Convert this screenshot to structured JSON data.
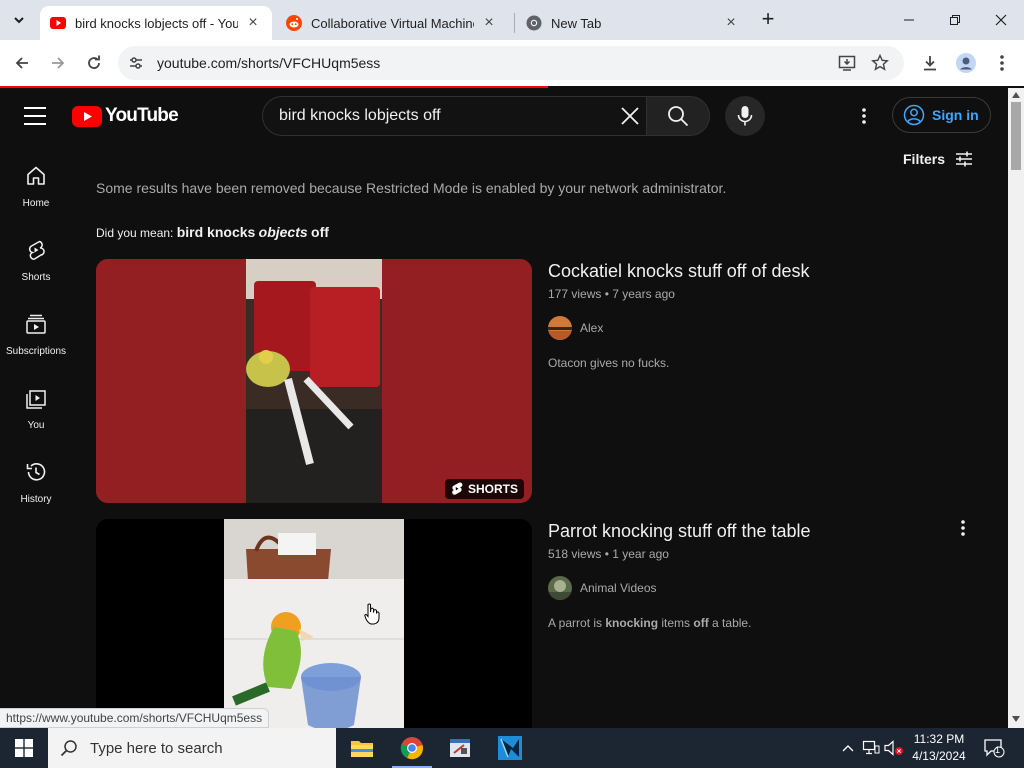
{
  "browser": {
    "tabs": [
      {
        "title": "bird knocks lobjects off - YouTu",
        "favicon": "youtube-icon"
      },
      {
        "title": "Collaborative Virtual Machines!",
        "favicon": "reddit-icon"
      },
      {
        "title": "New Tab",
        "favicon": "chrome-icon"
      }
    ],
    "url": "youtube.com/shorts/VFCHUqm5ess",
    "status_url": "https://www.youtube.com/shorts/VFCHUqm5ess"
  },
  "youtube": {
    "logo_text": "YouTube",
    "search_query": "bird knocks lobjects off",
    "sign_in_label": "Sign in",
    "guide": [
      {
        "label": "Home",
        "icon": "home-icon"
      },
      {
        "label": "Shorts",
        "icon": "shorts-icon"
      },
      {
        "label": "Subscriptions",
        "icon": "subscriptions-icon"
      },
      {
        "label": "You",
        "icon": "you-icon"
      },
      {
        "label": "History",
        "icon": "history-icon"
      }
    ],
    "filters_label": "Filters",
    "restricted_notice": "Some results have been removed because Restricted Mode is enabled by your network administrator.",
    "did_you_mean": {
      "prefix": "Did you mean:",
      "part1": "bird knocks",
      "part2": "objects",
      "part3": "off"
    },
    "results": [
      {
        "title": "Cockatiel knocks stuff off of desk",
        "views": "177 views",
        "age": "7 years ago",
        "channel": "Alex",
        "description": "Otacon gives no fucks.",
        "badge": "SHORTS"
      },
      {
        "title": "Parrot knocking stuff off the table",
        "views": "518 views",
        "age": "1 year ago",
        "channel": "Animal Videos",
        "description_parts": [
          "A parrot is ",
          "knocking",
          " items ",
          "off",
          " a table."
        ]
      }
    ]
  },
  "taskbar": {
    "search_placeholder": "Type here to search",
    "time": "11:32 PM",
    "date": "4/13/2024",
    "notification_count": "1"
  }
}
